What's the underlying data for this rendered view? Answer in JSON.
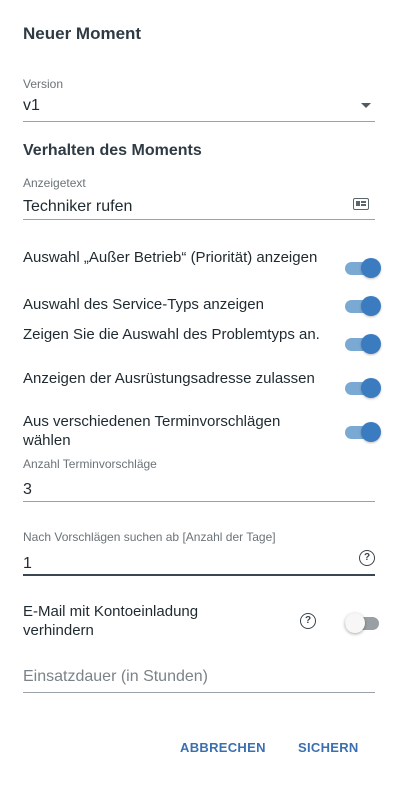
{
  "dialog": {
    "title": "Neuer Moment"
  },
  "version": {
    "label": "Version",
    "value": "v1"
  },
  "behavior": {
    "section_title": "Verhalten des Moments",
    "display_text": {
      "label": "Anzeigetext",
      "value": "Techniker rufen",
      "icon": "contact-card-icon"
    },
    "toggles": [
      {
        "label": "Auswahl „Außer Betrieb“ (Priorität) anzeigen",
        "on": true
      },
      {
        "label": "Auswahl des Service-Typs anzeigen",
        "on": true
      },
      {
        "label": "Zeigen Sie die Auswahl des Problemtyps an.",
        "on": true
      },
      {
        "label": "Anzeigen der Ausrüstungsadresse zulassen",
        "on": true
      },
      {
        "label": "Aus verschiedenen Terminvorschlägen wählen",
        "on": true
      }
    ],
    "suggestion_count": {
      "label": "Anzahl Terminvorschläge",
      "value": "3"
    },
    "search_from": {
      "label": "Nach Vorschlägen suchen ab [Anzahl der Tage]",
      "value": "1",
      "help_icon": "?"
    },
    "prevent_email": {
      "label": "E-Mail mit Kontoeinladung verhindern",
      "help_icon": "?",
      "on": false
    },
    "duration": {
      "placeholder": "Einsatzdauer (in Stunden)"
    }
  },
  "footer": {
    "cancel_label": "ABBRECHEN",
    "save_label": "SICHERN"
  },
  "colors": {
    "accent": "#3b7cc0",
    "button_text": "#3b6fb0",
    "toggle_track_on": "#7aa9d3",
    "toggle_track_off": "#9a9fa3"
  }
}
